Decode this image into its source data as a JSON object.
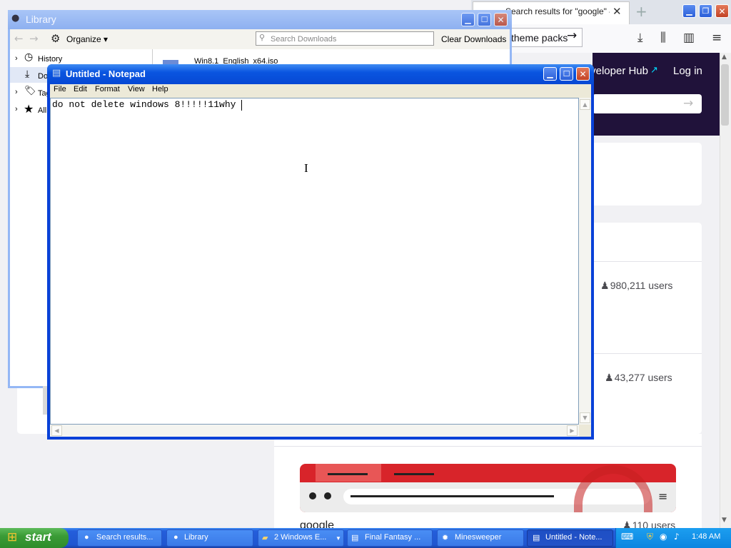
{
  "firefox": {
    "tab_title": "Search results for \"google\" – Add-ons",
    "tab_close": "✕",
    "new_tab": "+",
    "theme_button": "theme packs",
    "developer_hub": "Developer Hub",
    "login": "Log in",
    "results": [
      {
        "users": "980,211 users"
      },
      {
        "users": "43,277 users"
      },
      {
        "name": "google",
        "users": "110 users"
      }
    ]
  },
  "library": {
    "title": "Library",
    "organize": "Organize",
    "search_placeholder": "Search Downloads",
    "clear_downloads": "Clear Downloads",
    "tree": [
      "History",
      "Downloads",
      "Tags",
      "All Bookmarks"
    ],
    "download_item": "Win8.1_English_x64.iso"
  },
  "notepad": {
    "title": "Untitled - Notepad",
    "menu": [
      "File",
      "Edit",
      "Format",
      "View",
      "Help"
    ],
    "content": "do not delete windows 8!!!!!11why"
  },
  "taskbar": {
    "start": "start",
    "tasks": [
      {
        "label": "Search results...",
        "icon": "firefox-icon"
      },
      {
        "label": "Library",
        "icon": "firefox-icon"
      },
      {
        "label": "2 Windows E...",
        "icon": "folder-icon"
      },
      {
        "label": "Final Fantasy ...",
        "icon": "document-icon"
      },
      {
        "label": "Minesweeper",
        "icon": "mine-icon"
      },
      {
        "label": "Untitled - Note...",
        "icon": "notepad-icon"
      }
    ],
    "clock": "1:48 AM"
  },
  "colors": {
    "xp_blue": "#0a55e0",
    "start_green": "#3a9b36",
    "amo_header": "#20123a",
    "chrome_red": "#d8242a"
  }
}
